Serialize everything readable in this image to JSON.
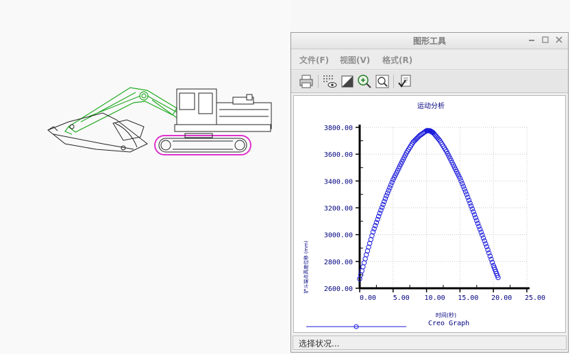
{
  "window": {
    "title": "图形工具",
    "min_icon": "minimize-icon",
    "max_icon": "maximize-icon",
    "close_icon": "close-icon"
  },
  "menu": {
    "items": [
      {
        "label": "文件(F)"
      },
      {
        "label": "视图(V)"
      },
      {
        "label": "格式(R)"
      }
    ]
  },
  "toolbar": {
    "icons": [
      "print-icon",
      "grid-view-icon",
      "background-icon",
      "zoom-in-icon",
      "zoom-fit-icon",
      "format-check-icon"
    ]
  },
  "status": {
    "text": "选择状况..."
  },
  "legend": {
    "label": "Creo Graph",
    "color": "#1a1adb"
  },
  "colors": {
    "series": "#1a1adb",
    "axis": "#000080"
  },
  "chart_data": {
    "type": "scatter",
    "title": "运动分析",
    "xlabel": "时间(秒)",
    "ylabel": "铲斗端点高度位移 (mm)",
    "xlim": [
      0,
      25
    ],
    "ylim": [
      2600,
      3800
    ],
    "x_ticks": [
      "0.00",
      "5.00",
      "10.00",
      "15.00",
      "20.00",
      "25.00"
    ],
    "y_ticks": [
      "2600.00",
      "2800.00",
      "3000.00",
      "3200.00",
      "3400.00",
      "3600.00",
      "3800.00"
    ],
    "grid": true,
    "legend_position": "bottom",
    "series": [
      {
        "name": "Creo Graph",
        "x": [
          0,
          1,
          2,
          3,
          4,
          5,
          6,
          7,
          8,
          9,
          10,
          10.5,
          11,
          12,
          13,
          14,
          15,
          16,
          17,
          18,
          19,
          20,
          20.7
        ],
        "y": [
          2670,
          2850,
          3020,
          3160,
          3290,
          3410,
          3510,
          3610,
          3690,
          3740,
          3775,
          3775,
          3760,
          3700,
          3620,
          3520,
          3420,
          3300,
          3170,
          3040,
          2910,
          2770,
          2680
        ]
      }
    ]
  }
}
